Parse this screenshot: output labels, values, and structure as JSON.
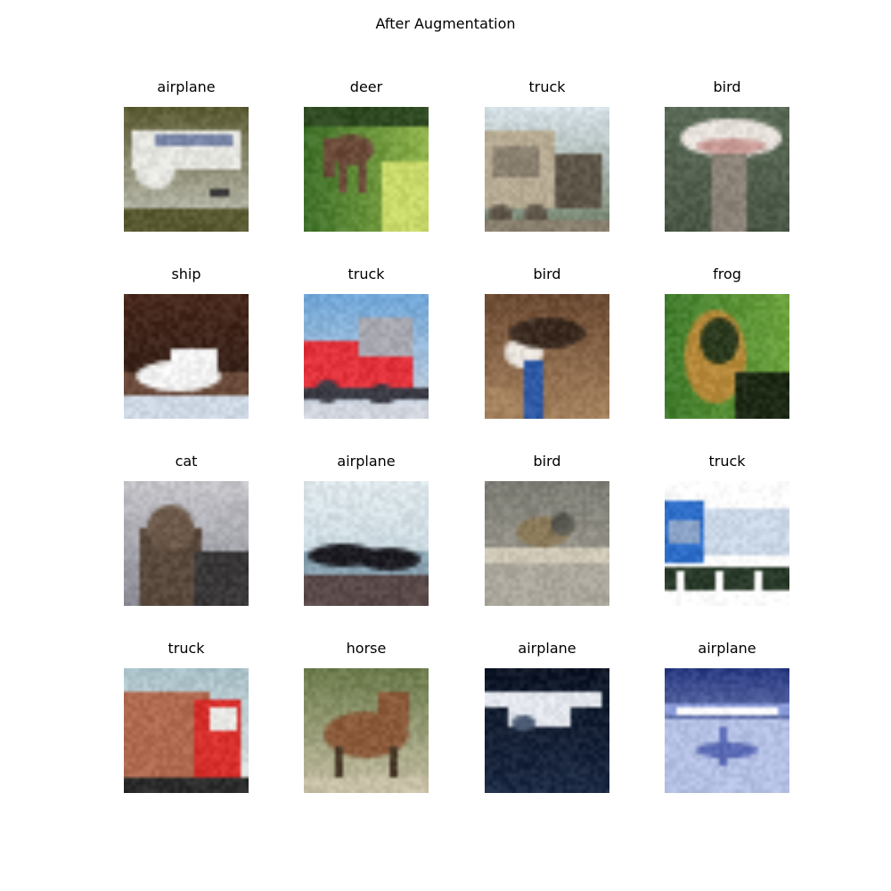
{
  "figure": {
    "title": "After Augmentation"
  },
  "images": [
    {
      "label": "airplane",
      "thumbnail": "airplane-on-tarmac",
      "colors": [
        "#5a5a32",
        "#c8c8c0",
        "#e6e6e1",
        "#7a86a8",
        "#3a3a3a"
      ]
    },
    {
      "label": "deer",
      "thumbnail": "deer-grazing-on-grass",
      "colors": [
        "#3e6f2a",
        "#8fb34a",
        "#c9d96a",
        "#6b4a3a",
        "#2f4a22"
      ]
    },
    {
      "label": "truck",
      "thumbnail": "vintage-truck-convoy",
      "colors": [
        "#8a8070",
        "#b7ab93",
        "#5e5648",
        "#d8e3ea",
        "#72806a"
      ]
    },
    {
      "label": "bird",
      "thumbnail": "ostrich-head-closeup",
      "colors": [
        "#5b6a57",
        "#8b8378",
        "#e7e1dc",
        "#c89a95",
        "#4a5646"
      ]
    },
    {
      "label": "ship",
      "thumbnail": "white-boat-on-water",
      "colors": [
        "#4a2a1e",
        "#f2f2f2",
        "#6a4a3a",
        "#ced8e4",
        "#2b1c16"
      ]
    },
    {
      "label": "truck",
      "thumbnail": "red-fire-truck",
      "colors": [
        "#6fa6d8",
        "#e2323c",
        "#a7a7b0",
        "#3a3a44",
        "#d0d4dc"
      ]
    },
    {
      "label": "bird",
      "thumbnail": "blue-neck-bird",
      "colors": [
        "#6b4a33",
        "#a5825e",
        "#2e5aa6",
        "#e9e3dd",
        "#3a2a20"
      ]
    },
    {
      "label": "frog",
      "thumbnail": "frog-on-leaves",
      "colors": [
        "#3f7a2c",
        "#2b3a1e",
        "#b68a3a",
        "#6ea33e",
        "#1f2a16"
      ]
    },
    {
      "label": "cat",
      "thumbnail": "tabby-cat",
      "colors": [
        "#8a8a94",
        "#5a4a3e",
        "#3a3838",
        "#c5c5ca",
        "#6e5a4a"
      ]
    },
    {
      "label": "airplane",
      "thumbnail": "plane-silhouette-sky",
      "colors": [
        "#b9ccd6",
        "#dfe8ec",
        "#1c1c22",
        "#5a4a4a",
        "#8aa3b2"
      ]
    },
    {
      "label": "bird",
      "thumbnail": "sparrow-on-fence",
      "colors": [
        "#7c7c74",
        "#aba79c",
        "#cfc8b7",
        "#8a7a5a",
        "#5a5a52"
      ]
    },
    {
      "label": "truck",
      "thumbnail": "blue-semi-truck",
      "colors": [
        "#ffffff",
        "#2e6ec8",
        "#c9d6e6",
        "#2a3a2a",
        "#8aa3c6"
      ]
    },
    {
      "label": "truck",
      "thumbnail": "red-delivery-truck",
      "colors": [
        "#a8c0c8",
        "#b06a50",
        "#d8302c",
        "#2c2c2c",
        "#e8e8e4"
      ]
    },
    {
      "label": "horse",
      "thumbnail": "brown-horse",
      "colors": [
        "#6a7a4a",
        "#8a5a3a",
        "#c7c0a6",
        "#4a3a2a",
        "#a58a6a"
      ]
    },
    {
      "label": "airplane",
      "thumbnail": "white-plane-dark-background",
      "colors": [
        "#1c2a44",
        "#e2e6ec",
        "#4a5a72",
        "#0e1626",
        "#8a9ab4"
      ]
    },
    {
      "label": "airplane",
      "thumbnail": "plane-over-airfield",
      "colors": [
        "#2a3a82",
        "#ffffff",
        "#8a9ad6",
        "#b4c0e4",
        "#5a6ab4"
      ]
    }
  ]
}
